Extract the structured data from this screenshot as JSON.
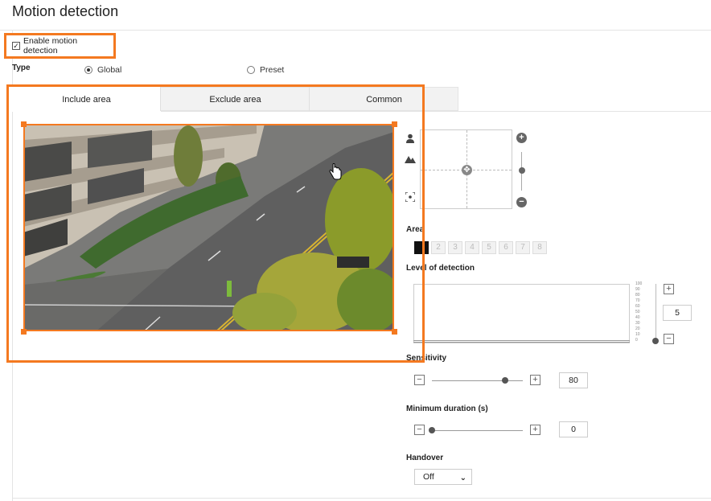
{
  "page": {
    "title": "Motion detection"
  },
  "enable": {
    "label": "Enable motion detection",
    "checked": true
  },
  "type": {
    "label": "Type",
    "options": [
      {
        "label": "Global",
        "selected": true
      },
      {
        "label": "Preset",
        "selected": false
      }
    ]
  },
  "tabs": [
    {
      "label": "Include area",
      "active": true
    },
    {
      "label": "Exclude area",
      "active": false
    },
    {
      "label": "Common",
      "active": false
    }
  ],
  "side_icons": [
    "person-icon",
    "mountain-icon",
    "focus-icon"
  ],
  "ptz": {
    "zoom_in": "+",
    "zoom_out": "−"
  },
  "area": {
    "label": "Area",
    "cells": [
      "1",
      "2",
      "3",
      "4",
      "5",
      "6",
      "7",
      "8"
    ],
    "active_index": 0
  },
  "level_of_detection": {
    "label": "Level of detection",
    "y_ticks": [
      "100",
      "90",
      "80",
      "70",
      "60",
      "50",
      "40",
      "30",
      "20",
      "10",
      "0"
    ],
    "value": "5"
  },
  "sensitivity": {
    "label": "Sensitivity",
    "value": "80"
  },
  "minimum_duration": {
    "label": "Minimum duration (s)",
    "value": "0"
  },
  "handover": {
    "label": "Handover",
    "selected": "Off"
  },
  "colors": {
    "highlight": "#f47920"
  }
}
